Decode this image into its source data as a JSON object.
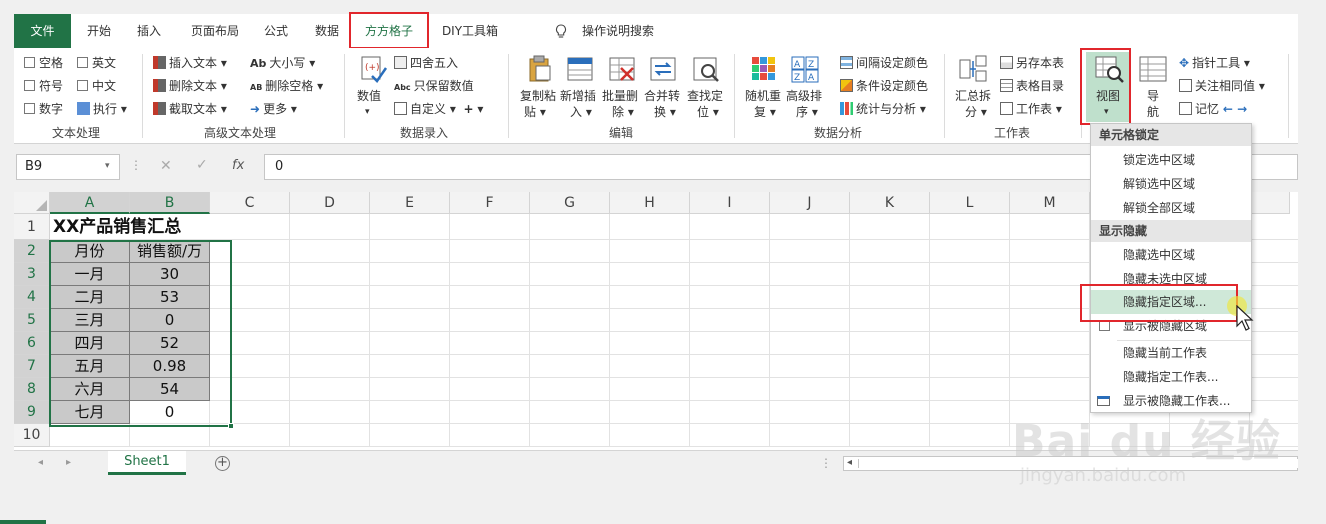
{
  "tabs": [
    "文件",
    "开始",
    "插入",
    "页面布局",
    "公式",
    "数据",
    "方方格子",
    "DIY工具箱"
  ],
  "tell_me": "操作说明搜索",
  "ribbon": {
    "text_proc": {
      "items": [
        "空格",
        "英文",
        "符号",
        "中文",
        "数字",
        "执行"
      ],
      "label": "文本处理"
    },
    "adv_text": {
      "items": [
        "插入文本",
        "删除文本",
        "截取文本",
        "大小写",
        "删除空格",
        "更多"
      ],
      "label": "高级文本处理"
    },
    "data_entry": {
      "big": "数值",
      "items": [
        "四舍五入",
        "只保留数值",
        "自定义"
      ],
      "label": "数据录入"
    },
    "edit": {
      "b1": [
        "复制粘",
        "贴"
      ],
      "b2": [
        "新增插",
        "入"
      ],
      "b3": [
        "批量删",
        "除"
      ],
      "b4": [
        "合并转",
        "换"
      ],
      "b5": [
        "查找定",
        "位"
      ],
      "label": "编辑"
    },
    "analysis": {
      "b1": [
        "随机重",
        "复"
      ],
      "b2": [
        "高级排",
        "序"
      ],
      "items": [
        "间隔设定颜色",
        "条件设定颜色",
        "统计与分析"
      ],
      "label": "数据分析"
    },
    "sheet": {
      "b1": [
        "汇总拆",
        "分"
      ],
      "items": [
        "另存本表",
        "表格目录",
        "工作表"
      ],
      "label": "工作表"
    },
    "view": {
      "big": "视图",
      "nav": [
        "导",
        "航"
      ],
      "items": [
        "指针工具",
        "关注相同值",
        "记忆"
      ]
    }
  },
  "namebox": "B9",
  "fx": "fx",
  "formula_value": "0",
  "columns": [
    "A",
    "B",
    "C",
    "D",
    "E",
    "F",
    "G",
    "H",
    "I",
    "J",
    "K",
    "L",
    "M"
  ],
  "rows": [
    "1",
    "2",
    "3",
    "4",
    "5",
    "6",
    "7",
    "8",
    "9",
    "10"
  ],
  "sheet_title": "XX产品销售汇总",
  "table_header": [
    "月份",
    "销售额/万元"
  ],
  "table_rows": [
    [
      "一月",
      "30"
    ],
    [
      "二月",
      "53"
    ],
    [
      "三月",
      "0"
    ],
    [
      "四月",
      "52"
    ],
    [
      "五月",
      "0.98"
    ],
    [
      "六月",
      "54"
    ],
    [
      "七月",
      "0"
    ]
  ],
  "sheet_tab": "Sheet1",
  "dropdown": {
    "sec1": "单元格锁定",
    "lock": [
      "锁定选中区域",
      "解锁选中区域",
      "解锁全部区域"
    ],
    "sec2": "显示隐藏",
    "hide": [
      "隐藏选中区域",
      "隐藏未选中区域",
      "隐藏指定区域...",
      "显示被隐藏区域"
    ],
    "sheets": [
      "隐藏当前工作表",
      "隐藏指定工作表...",
      "显示被隐藏工作表..."
    ]
  },
  "watermark": {
    "brand": "Bai du 经验",
    "url": "jingyan.baidu.com"
  },
  "colors": {
    "excel_green": "#217346",
    "highlight_red": "#e1262c",
    "cell_gray": "#c9c9c9",
    "menu_hover": "#cfe8d8"
  }
}
